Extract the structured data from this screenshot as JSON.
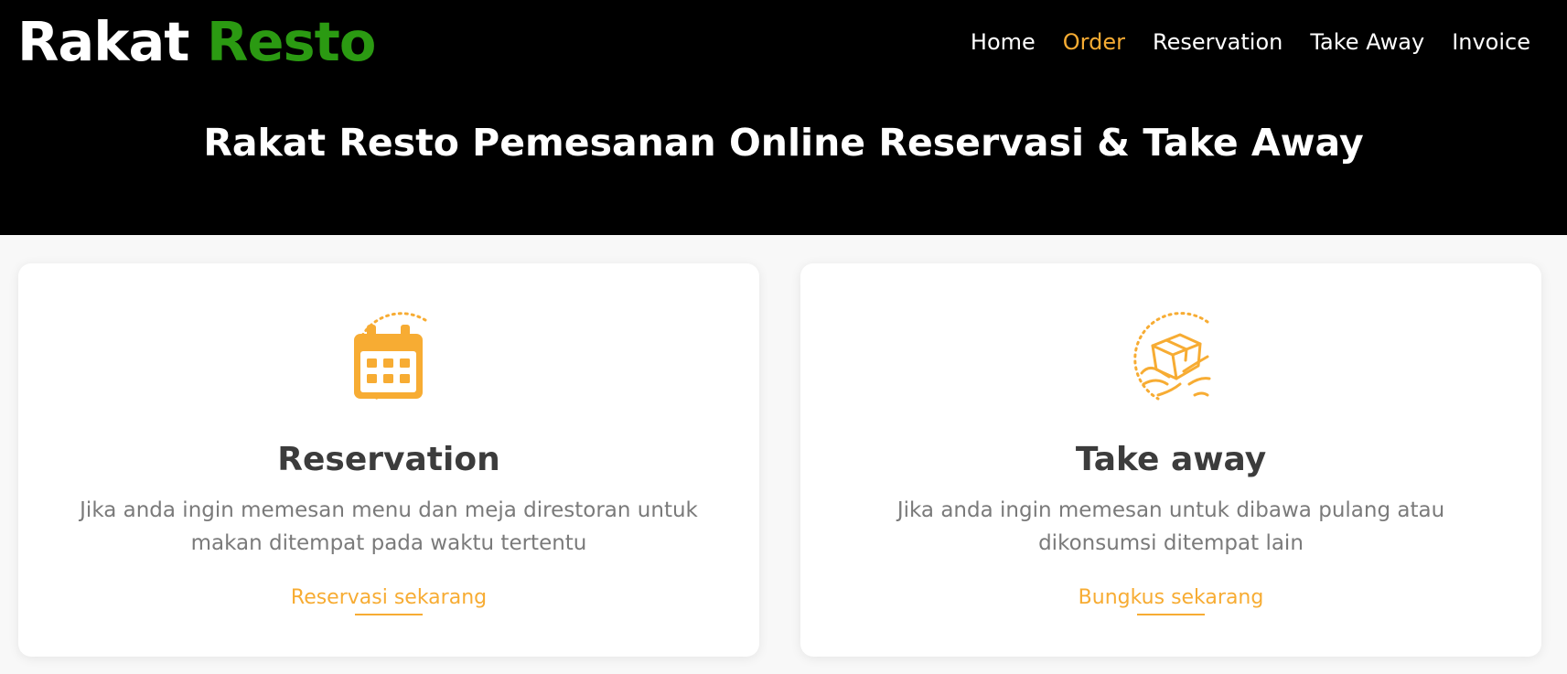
{
  "brand": {
    "name_part1": "Rakat",
    "name_part2": "Resto"
  },
  "nav": {
    "items": [
      {
        "label": "Home",
        "active": false
      },
      {
        "label": "Order",
        "active": true
      },
      {
        "label": "Reservation",
        "active": false
      },
      {
        "label": "Take Away",
        "active": false
      },
      {
        "label": "Invoice",
        "active": false
      }
    ]
  },
  "hero": {
    "title": "Rakat Resto Pemesanan Online Reservasi & Take Away"
  },
  "cards": [
    {
      "icon": "calendar-icon",
      "title": "Reservation",
      "description": "Jika anda ingin memesan menu dan meja direstoran untuk makan ditempat pada waktu tertentu",
      "cta": "Reservasi sekarang"
    },
    {
      "icon": "takeaway-box-icon",
      "title": "Take away",
      "description": "Jika anda ingin memesan untuk dibawa pulang atau dikonsumsi ditempat lain",
      "cta": "Bungkus sekarang"
    }
  ],
  "colors": {
    "accent": "#f7ac33",
    "brand_green": "#2b9a12",
    "header_bg": "#000000",
    "heading_text": "#3c3c3c",
    "body_text": "#7a7a7a"
  }
}
